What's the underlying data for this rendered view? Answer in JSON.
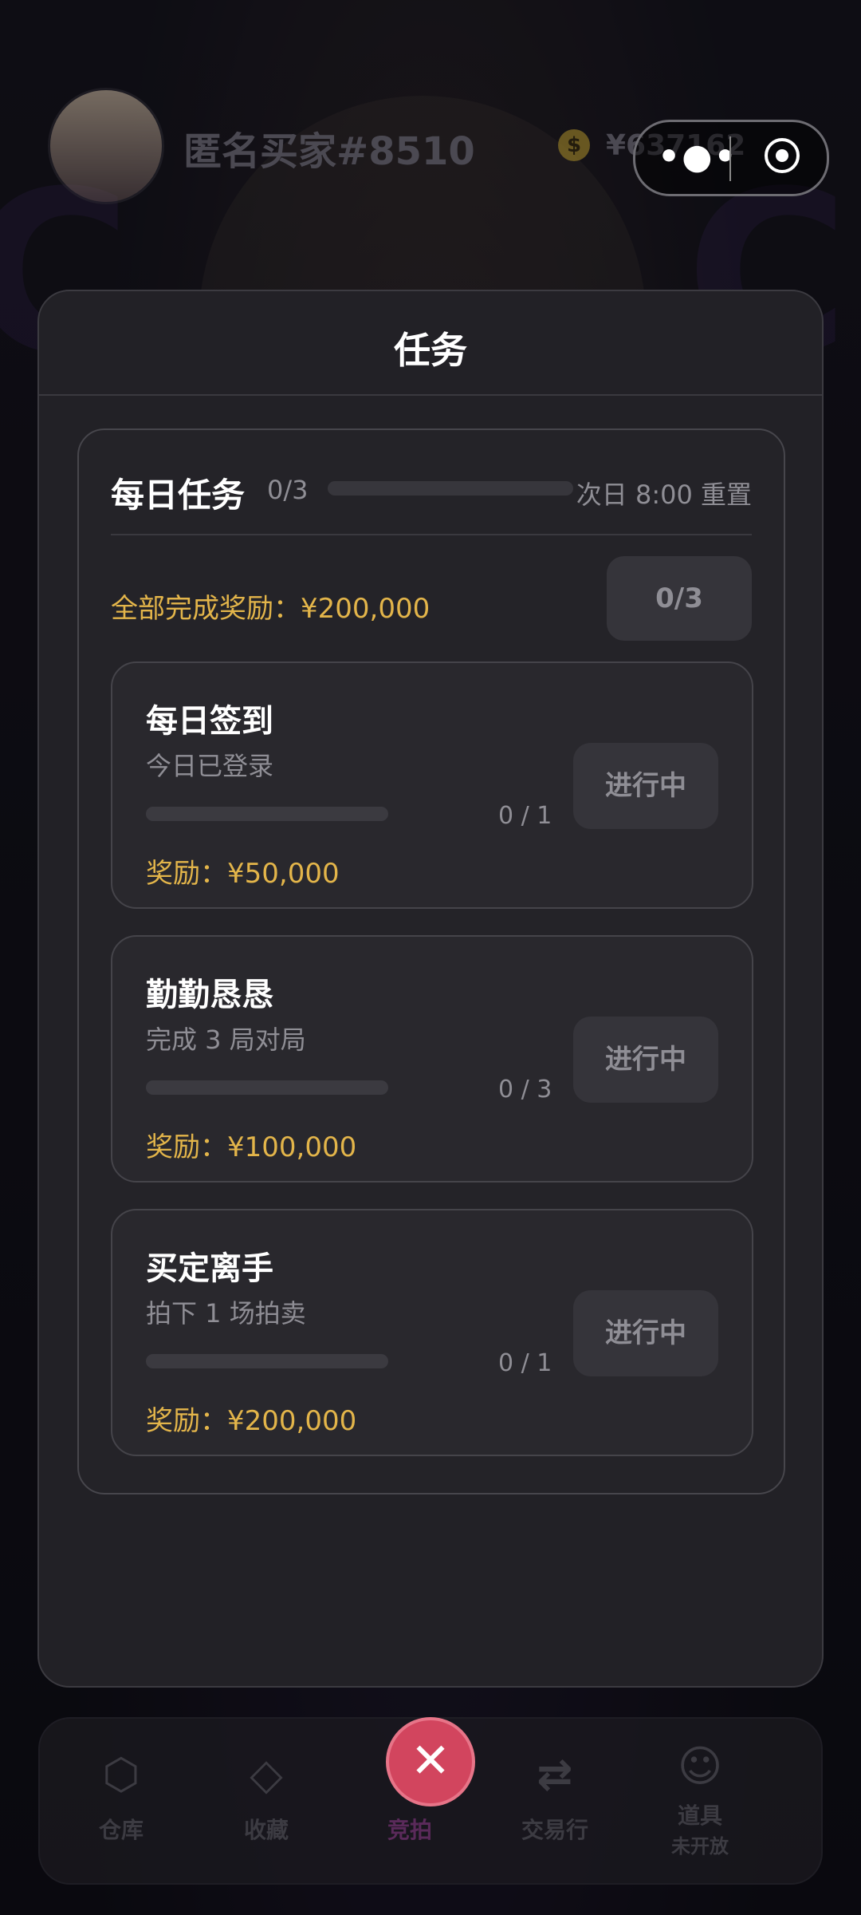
{
  "header": {
    "username": "匿名买家#8510",
    "coin_symbol": "$",
    "balance": "¥637162",
    "capsule_more": "•●•"
  },
  "modal": {
    "title": "任务"
  },
  "daily": {
    "title": "每日任务",
    "count": "0/3",
    "progress_fraction": 0,
    "reset_text": "次日 8:00 重置",
    "all_reward_text": "全部完成奖励：¥200,000",
    "claim_button": "0/3"
  },
  "tasks": [
    {
      "name": "每日签到",
      "desc": "今日已登录",
      "progress": "0 / 1",
      "progress_fraction": 0,
      "reward": "奖励：¥50,000",
      "status": "进行中"
    },
    {
      "name": "勤勤恳恳",
      "desc": "完成 3 局对局",
      "progress": "0 / 3",
      "progress_fraction": 0,
      "reward": "奖励：¥100,000",
      "status": "进行中"
    },
    {
      "name": "买定离手",
      "desc": "拍下 1 场拍卖",
      "progress": "0 / 1",
      "progress_fraction": 0,
      "reward": "奖励：¥200,000",
      "status": "进行中"
    }
  ],
  "nav": {
    "items": [
      {
        "label": "仓库",
        "icon": "box-icon"
      },
      {
        "label": "收藏",
        "icon": "diamond-icon"
      },
      {
        "label": "竞拍",
        "icon": "close-icon"
      },
      {
        "label": "交易行",
        "icon": "swap-icon"
      },
      {
        "label": "道具",
        "sub": "未开放",
        "icon": "person-icon"
      }
    ]
  },
  "colors": {
    "accent_gold": "#e3b54a",
    "close_button": "#d2455e",
    "modal_bg": "#222126"
  }
}
